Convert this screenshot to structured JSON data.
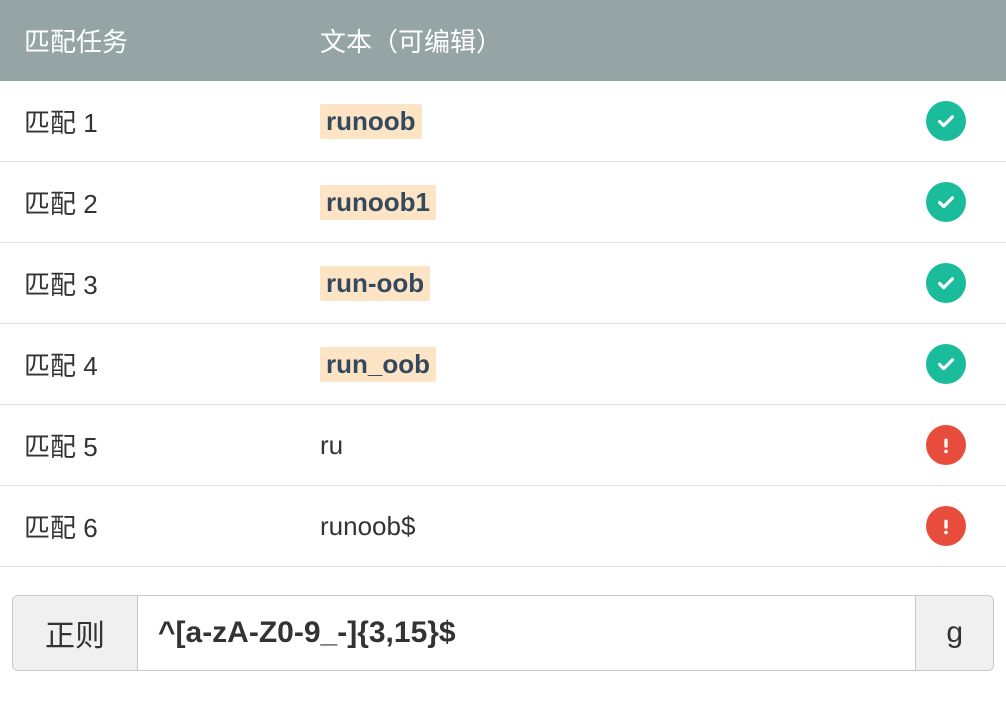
{
  "header": {
    "task_col": "匹配任务",
    "text_col": "文本（可编辑）"
  },
  "rows": [
    {
      "task": "匹配 1",
      "text": "runoob",
      "matched": true,
      "status": "success"
    },
    {
      "task": "匹配 2",
      "text": "runoob1",
      "matched": true,
      "status": "success"
    },
    {
      "task": "匹配 3",
      "text": "run-oob",
      "matched": true,
      "status": "success"
    },
    {
      "task": "匹配 4",
      "text": "run_oob",
      "matched": true,
      "status": "success"
    },
    {
      "task": "匹配 5",
      "text": "ru",
      "matched": false,
      "status": "error"
    },
    {
      "task": "匹配 6",
      "text": "runoob$",
      "matched": false,
      "status": "error"
    }
  ],
  "regex": {
    "label": "正则",
    "pattern": "^[a-zA-Z0-9_-]{3,15}$",
    "flags": "g"
  }
}
